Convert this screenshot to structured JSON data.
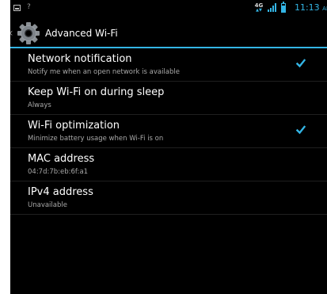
{
  "status_bar": {
    "network_type": "4G",
    "clock": "11:13",
    "clock_suffix": "AM",
    "accent_color": "#33b5e5",
    "signal_level": 4,
    "icons": [
      "notification-icon",
      "wifi-unknown-icon",
      "4g-icon",
      "signal-icon",
      "battery-icon"
    ]
  },
  "action_bar": {
    "title": "Advanced Wi-Fi",
    "icons": [
      "up-chevron-icon",
      "settings-gear-icon"
    ]
  },
  "preferences": [
    {
      "title": "Network notification",
      "summary": "Notify me when an open network is available",
      "has_checkbox": true,
      "checked": true
    },
    {
      "title": "Keep Wi-Fi on during sleep",
      "summary": "Always",
      "has_checkbox": false
    },
    {
      "title": "Wi-Fi optimization",
      "summary": "Minimize battery usage when Wi-Fi is on",
      "has_checkbox": true,
      "checked": true
    },
    {
      "title": "MAC address",
      "summary": "04:7d:7b:eb:6f:a1",
      "has_checkbox": false
    },
    {
      "title": "IPv4 address",
      "summary": "Unavailable",
      "has_checkbox": false
    }
  ],
  "colors": {
    "background": "#000000",
    "accent": "#33b5e5",
    "title_text": "#ffffff",
    "summary_text": "#a8a8a8",
    "divider": "#1f1f1f"
  }
}
